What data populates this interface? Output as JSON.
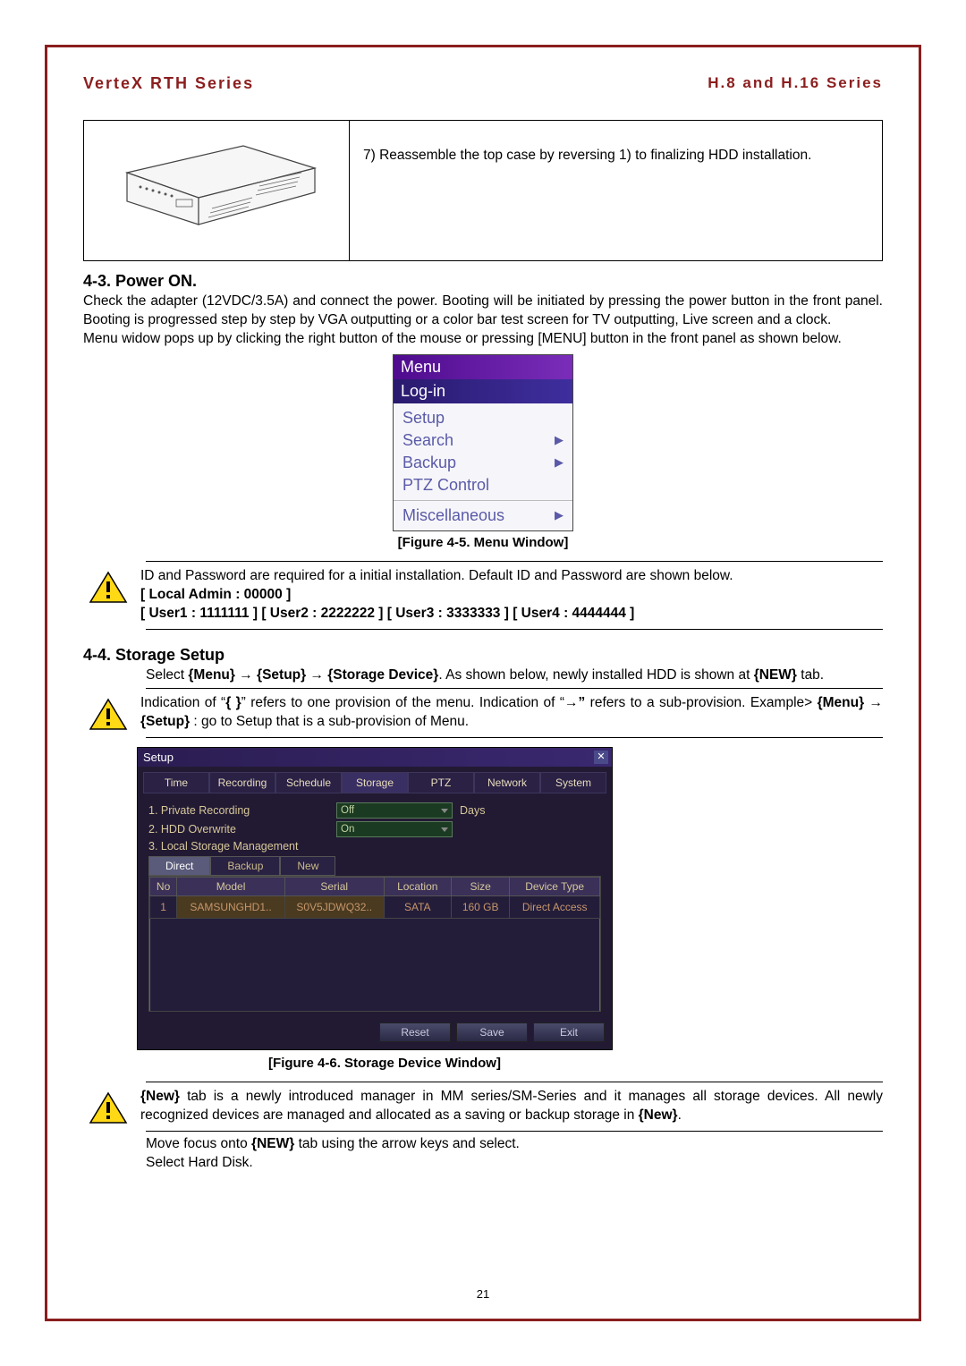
{
  "header": {
    "left": "VerteX RTH Series",
    "right": "H.8 and H.16 Series"
  },
  "step7": "7) Reassemble the top case by reversing 1) to finalizing HDD installation.",
  "s43": {
    "title": "4-3.  Power ON.",
    "body": "Check the adapter (12VDC/3.5A) and connect the power. Booting will be initiated by pressing the power button in the front panel. Booting is progressed step by step by VGA outputting or a color bar test screen for TV outputting, Live screen and a clock.",
    "body2": "Menu widow pops up by clicking the right button of the mouse or pressing [MENU] button in the front panel as shown below."
  },
  "menu": {
    "title": "Menu",
    "login": "Log-in",
    "setup": "Setup",
    "search": "Search",
    "backup": "Backup",
    "ptz": "PTZ Control",
    "misc": "Miscellaneous"
  },
  "fig45": "[Figure 4-5. Menu Window]",
  "note1": {
    "l1": "ID and Password are required for a initial installation. Default ID and Password are shown below.",
    "l2": "[ Local Admin : 00000 ]",
    "l3": "[ User1 : 1111111 ] [ User2 : 2222222 ] [ User3 : 3333333 ] [ User4 : 4444444 ]"
  },
  "s44": {
    "title": "4-4.  Storage Setup",
    "body_a": "Select ",
    "body_b": "{Menu} → {Setup} → {Storage Device}",
    "body_c": ". As shown below, newly installed HDD is shown at ",
    "body_d": "{NEW}",
    "body_e": " tab."
  },
  "note2": {
    "a": "Indication of “",
    "b": "{    }",
    "c": "” refers to one provision of the menu. Indication of “",
    "d": "→”",
    "e": " refers to a sub-provision. Example> ",
    "f1": "{Menu}",
    "arrow": " → ",
    "f2": "{Setup}",
    "g": " : go to Setup that is a sub-provision of Menu."
  },
  "setup": {
    "title": "Setup",
    "tabs": [
      "Time",
      "Recording",
      "Schedule",
      "Storage",
      "PTZ",
      "Network",
      "System"
    ],
    "opt1_lbl": "1. Private Recording",
    "opt1_val": "Off",
    "opt1_suffix": "Days",
    "opt2_lbl": "2. HDD Overwrite",
    "opt2_val": "On",
    "opt3_lbl": "3. Local Storage Management",
    "subtabs": [
      "Direct",
      "Backup",
      "New"
    ],
    "cols": [
      "No",
      "Model",
      "Serial",
      "Location",
      "Size",
      "Device Type"
    ],
    "row": [
      "1",
      "SAMSUNGHD1..",
      "S0V5JDWQ32..",
      "SATA",
      "160 GB",
      "Direct Access"
    ],
    "btns": [
      "Reset",
      "Save",
      "Exit"
    ]
  },
  "fig46": "[Figure 4-6. Storage Device Window]",
  "note3": {
    "a1": "{New}",
    "a2": " tab is a newly introduced manager in MM series/SM-Series and it manages all storage devices. All newly recognized devices are managed and allocated as a saving or backup storage in ",
    "a3": "{New}",
    "a4": "."
  },
  "tail": {
    "l1a": "Move focus onto ",
    "l1b": "{NEW}",
    "l1c": " tab using the arrow keys and select.",
    "l2": "Select Hard Disk."
  },
  "page_num": "21"
}
